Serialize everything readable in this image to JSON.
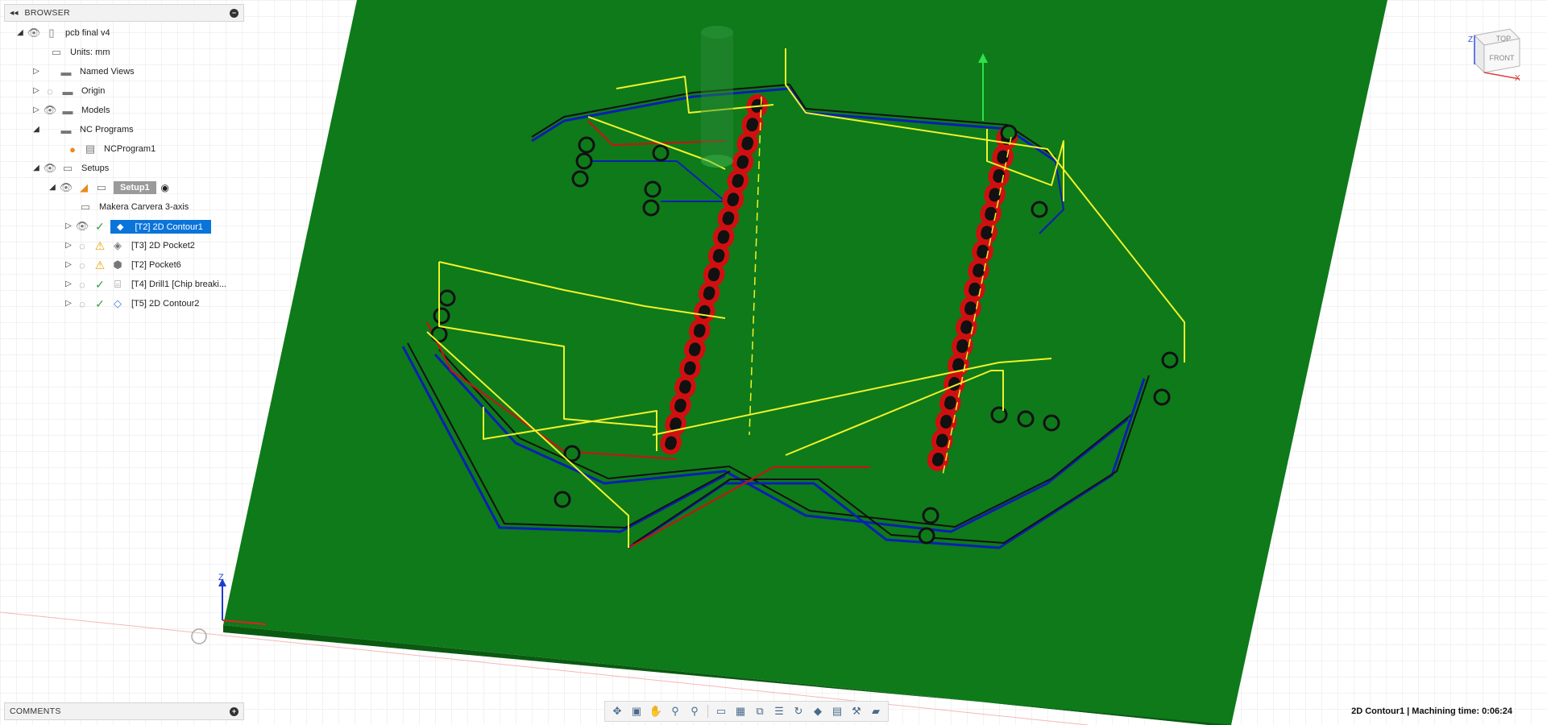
{
  "browser": {
    "title": "BROWSER",
    "root": "pcb final v4",
    "units": "Units: mm",
    "named_views": "Named Views",
    "origin": "Origin",
    "models": "Models",
    "nc_programs": "NC Programs",
    "nc_program1": "NCProgram1",
    "setups": "Setups",
    "setup1": "Setup1",
    "machine": "Makera Carvera 3-axis",
    "ops": [
      {
        "label": "[T2] 2D Contour1",
        "status": "ok"
      },
      {
        "label": "[T3] 2D Pocket2",
        "status": "warning"
      },
      {
        "label": "[T2] Pocket6",
        "status": "warning"
      },
      {
        "label": "[T4] Drill1 [Chip breaki...",
        "status": "ok"
      },
      {
        "label": "[T5] 2D Contour2",
        "status": "ok"
      }
    ]
  },
  "comments": {
    "title": "COMMENTS"
  },
  "viewcube": {
    "top": "TOP",
    "front": "FRONT",
    "z": "Z",
    "x": "X"
  },
  "triad": {
    "z": "Z"
  },
  "status": {
    "text": "2D Contour1 | Machining time: 0:06:24"
  },
  "colors": {
    "board": "#0e7a1a",
    "board_edge": "#0a5a12",
    "toolpath_yellow": "#f2f22a",
    "toolpath_red": "#d01010",
    "toolpath_blue": "#0b1fb4",
    "selection": "#0a74da"
  }
}
